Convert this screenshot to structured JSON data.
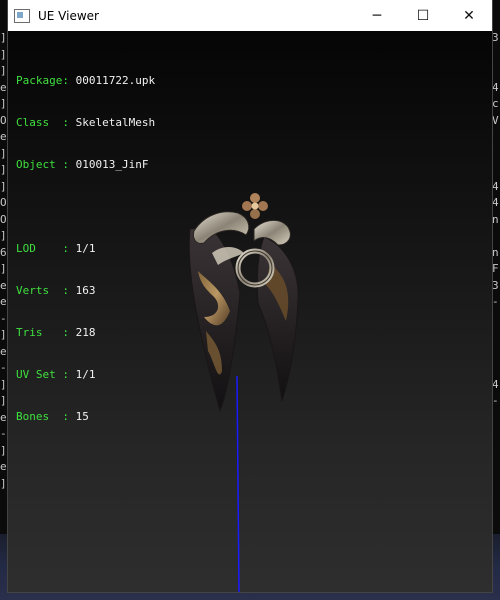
{
  "window": {
    "title": "UE Viewer",
    "controls": {
      "minimize": "─",
      "maximize": "☐",
      "close": "✕"
    }
  },
  "info": {
    "package_label": "Package:",
    "package": "00011722.upk",
    "class_label": "Class  :",
    "class": "SkeletalMesh",
    "object_label": "Object :",
    "object": "010013_JinF",
    "lod_label": "LOD    :",
    "lod": "1/1",
    "verts_label": "Verts  :",
    "verts": "163",
    "tris_label": "Tris   :",
    "tris": "218",
    "uvset_label": "UV Set :",
    "uvset": "1/1",
    "bones_label": "Bones  :",
    "bones": "15"
  },
  "background_console": {
    "left_chars": [
      "]",
      "]",
      "]",
      "e",
      "]",
      "O",
      "e",
      "]",
      "]",
      "]",
      "O",
      "O",
      "]",
      "6",
      "]",
      "e",
      "e",
      "-",
      "]",
      "e",
      "-",
      "]",
      "]",
      "e",
      "-",
      "]",
      "e",
      "]"
    ],
    "right_chars": [
      "3",
      "",
      "",
      "4",
      "c",
      "V",
      "",
      "",
      "",
      "4",
      "4",
      "n",
      "",
      "n",
      "F",
      "3",
      "-",
      "",
      "",
      "",
      "",
      "4",
      "-",
      "",
      ""
    ]
  },
  "colors": {
    "label_green": "#3fe03f",
    "value_white": "#f2f2f2",
    "bone_line": "#1a1aff"
  }
}
